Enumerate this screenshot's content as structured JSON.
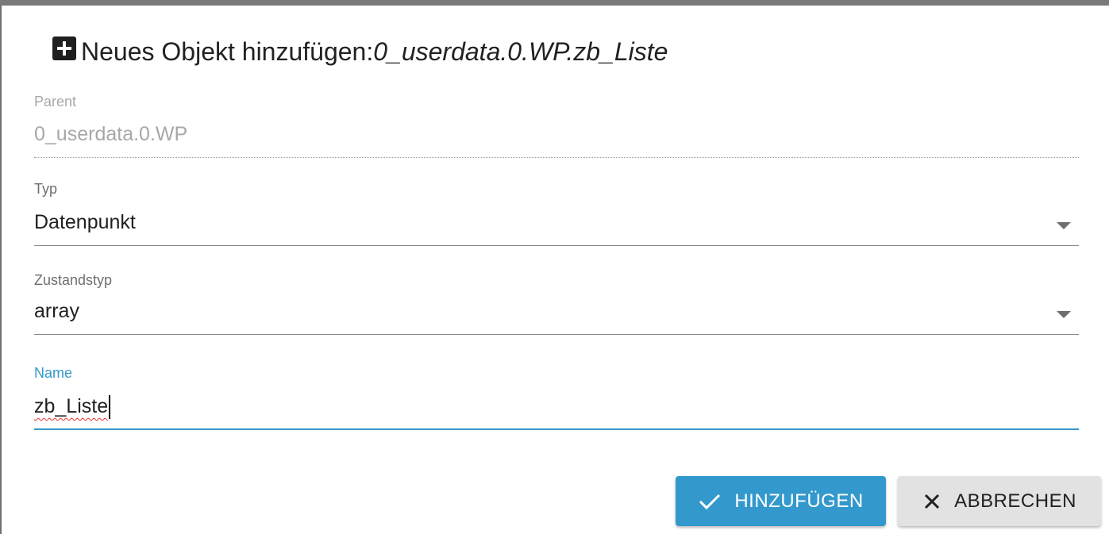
{
  "dialog": {
    "title_prefix": "Neues Objekt hinzufügen:",
    "title_object_id": "0_userdata.0.WP.zb_Liste",
    "title_icon": "plus-box-icon"
  },
  "fields": {
    "parent": {
      "label": "Parent",
      "value": "0_userdata.0.WP",
      "disabled": true
    },
    "type": {
      "label": "Typ",
      "selected": "Datenpunkt",
      "icon": "chevron-down-icon"
    },
    "state_type": {
      "label": "Zustandstyp",
      "selected": "array",
      "icon": "chevron-down-icon"
    },
    "name": {
      "label": "Name",
      "value": "zb_Liste",
      "focused": true
    }
  },
  "buttons": {
    "add_label": "HINZUFÜGEN",
    "add_icon": "check-icon",
    "cancel_label": "ABBRECHEN",
    "cancel_icon": "close-icon"
  },
  "colors": {
    "accent": "#3399cc",
    "secondary_button": "#e2e2e2",
    "disabled_text": "#a8a8a8",
    "spellcheck": "#e03030"
  }
}
